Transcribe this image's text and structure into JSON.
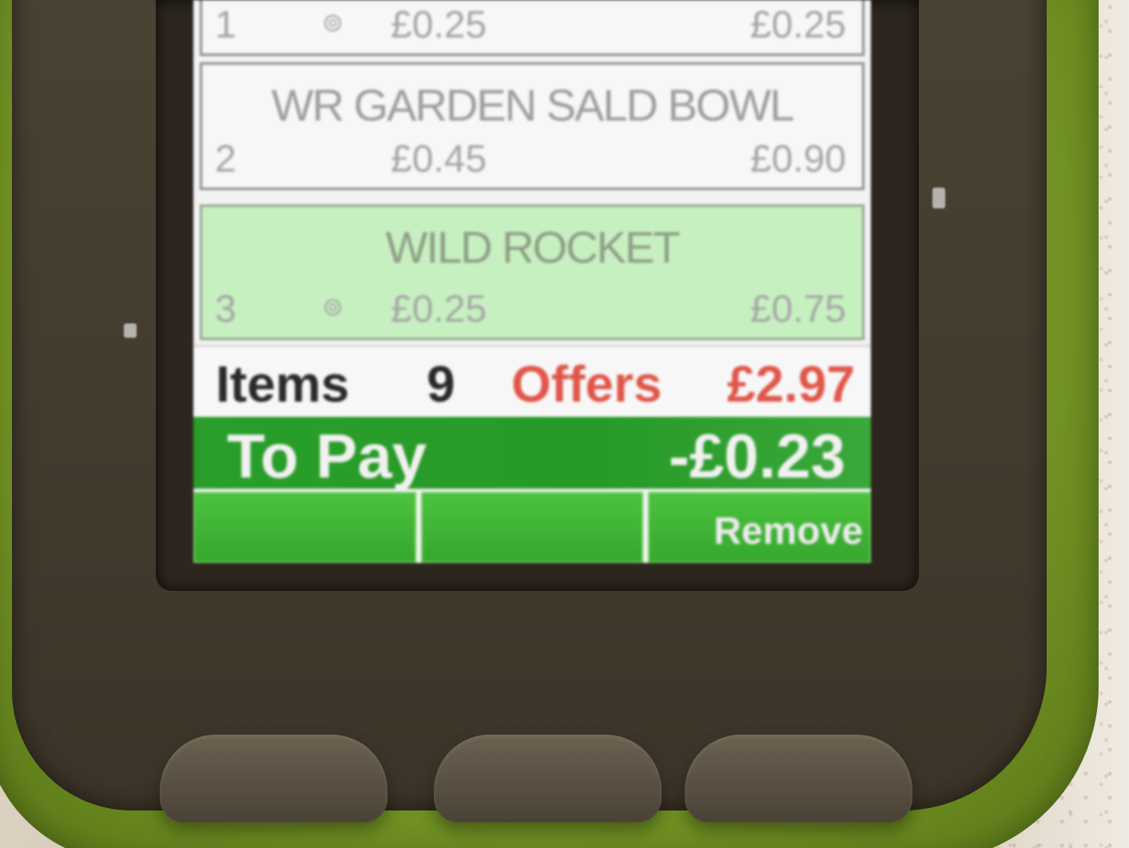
{
  "items": [
    {
      "name": "",
      "qty": "1",
      "offer_icon": "offer-icon",
      "unit_price": "£0.25",
      "total": "£0.25"
    },
    {
      "name": "WR GARDEN SALD BOWL",
      "qty": "2",
      "unit_price": "£0.45",
      "total": "£0.90"
    },
    {
      "name": "WILD ROCKET",
      "qty": "3",
      "offer_icon": "offer-icon",
      "unit_price": "£0.25",
      "total": "£0.75"
    }
  ],
  "summary": {
    "items_label": "Items",
    "items_count": "9",
    "offers_label": "Offers",
    "offers_value": "£2.97"
  },
  "topay": {
    "label": "To Pay",
    "value": "-£0.23"
  },
  "softkeys": [
    "",
    "",
    "Remove"
  ],
  "colors": {
    "device_green": "#7ea12b",
    "pay_bar": "#2a9e2a",
    "offers_red": "#e0574a",
    "selected_row": "#c7f0c1",
    "softkey": "#3fb535"
  }
}
